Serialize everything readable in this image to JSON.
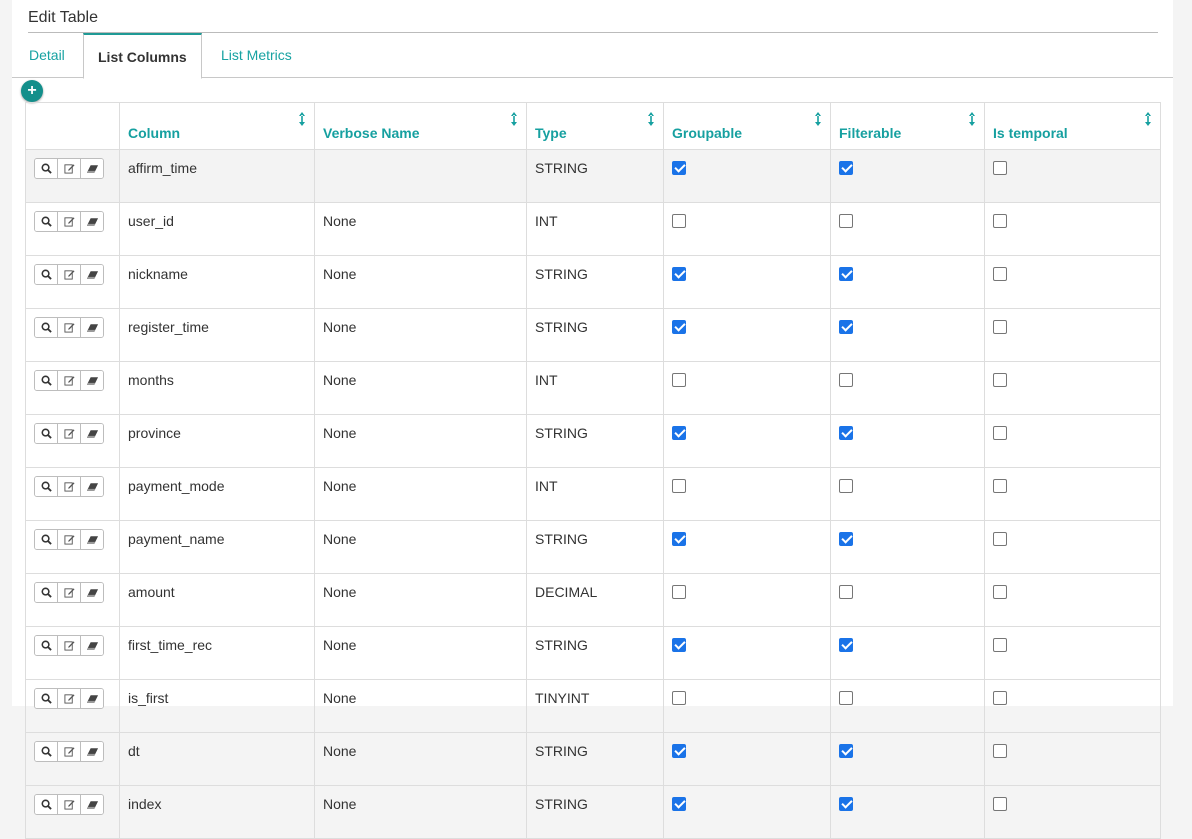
{
  "title": "Edit Table",
  "tabs": [
    {
      "label": "Detail",
      "active": false
    },
    {
      "label": "List Columns",
      "active": true
    },
    {
      "label": "List Metrics",
      "active": false
    }
  ],
  "add_button_label": "+",
  "colors": {
    "accent": "#16a0a0",
    "add_button": "#138f8b",
    "checkbox": "#1a73e8"
  },
  "icons": {
    "sort": "sort-arrows-icon",
    "add": "plus-circle-icon",
    "view": "search-icon",
    "edit": "edit-icon",
    "delete": "eraser-icon"
  },
  "headers": [
    "Column",
    "Verbose Name",
    "Type",
    "Groupable",
    "Filterable",
    "Is temporal"
  ],
  "rows": [
    {
      "column": "affirm_time",
      "verbose": "",
      "type": "STRING",
      "groupable": true,
      "filterable": true,
      "temporal": false
    },
    {
      "column": "user_id",
      "verbose": "None",
      "type": "INT",
      "groupable": false,
      "filterable": false,
      "temporal": false
    },
    {
      "column": "nickname",
      "verbose": "None",
      "type": "STRING",
      "groupable": true,
      "filterable": true,
      "temporal": false
    },
    {
      "column": "register_time",
      "verbose": "None",
      "type": "STRING",
      "groupable": true,
      "filterable": true,
      "temporal": false
    },
    {
      "column": "months",
      "verbose": "None",
      "type": "INT",
      "groupable": false,
      "filterable": false,
      "temporal": false
    },
    {
      "column": "province",
      "verbose": "None",
      "type": "STRING",
      "groupable": true,
      "filterable": true,
      "temporal": false
    },
    {
      "column": "payment_mode",
      "verbose": "None",
      "type": "INT",
      "groupable": false,
      "filterable": false,
      "temporal": false
    },
    {
      "column": "payment_name",
      "verbose": "None",
      "type": "STRING",
      "groupable": true,
      "filterable": true,
      "temporal": false
    },
    {
      "column": "amount",
      "verbose": "None",
      "type": "DECIMAL",
      "groupable": false,
      "filterable": false,
      "temporal": false
    },
    {
      "column": "first_time_rec",
      "verbose": "None",
      "type": "STRING",
      "groupable": true,
      "filterable": true,
      "temporal": false
    },
    {
      "column": "is_first",
      "verbose": "None",
      "type": "TINYINT",
      "groupable": false,
      "filterable": false,
      "temporal": false
    },
    {
      "column": "dt",
      "verbose": "None",
      "type": "STRING",
      "groupable": true,
      "filterable": true,
      "temporal": false
    },
    {
      "column": "index",
      "verbose": "None",
      "type": "STRING",
      "groupable": true,
      "filterable": true,
      "temporal": false
    }
  ]
}
